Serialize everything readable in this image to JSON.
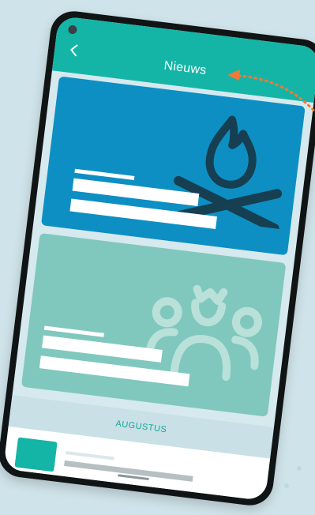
{
  "appbar": {
    "title": "Nieuws",
    "back_icon": "chevron-left-icon"
  },
  "cards": [
    {
      "icon": "campfire-icon",
      "background": "#0d8fc3"
    },
    {
      "icon": "family-crown-icon",
      "background": "#80c8bd"
    }
  ],
  "list": {
    "month_header": "AUGUSTUS"
  },
  "colors": {
    "brand": "#14b5a6",
    "accent_arrow": "#f07a35",
    "background": "#cfe4ea",
    "icon_dark": "#163f52"
  }
}
